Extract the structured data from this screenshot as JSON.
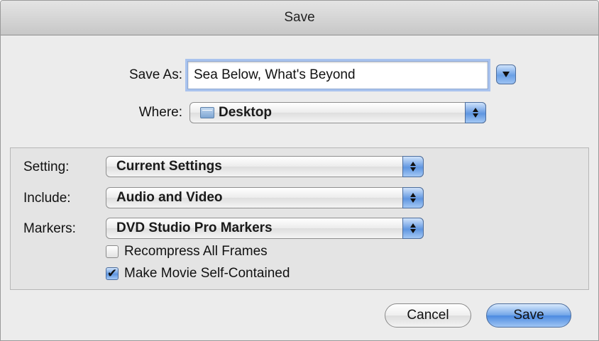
{
  "window": {
    "title": "Save"
  },
  "save_as": {
    "label": "Save As:",
    "value": "Sea Below, What's Beyond"
  },
  "where": {
    "label": "Where:",
    "value": "Desktop"
  },
  "options": {
    "setting": {
      "label": "Setting:",
      "value": "Current Settings"
    },
    "include": {
      "label": "Include:",
      "value": "Audio and Video"
    },
    "markers": {
      "label": "Markers:",
      "value": "DVD Studio Pro Markers"
    },
    "recompress": {
      "label": "Recompress All Frames",
      "checked": false
    },
    "self_contained": {
      "label": "Make Movie Self-Contained",
      "checked": true
    }
  },
  "buttons": {
    "cancel": "Cancel",
    "save": "Save"
  },
  "icons": {
    "expand": "chevron-down-icon",
    "folder": "folder-icon",
    "popup_arrows": "up-down-arrows-icon",
    "check": "checkmark-icon"
  },
  "colors": {
    "accent": "#6aa0e6",
    "focus_ring": "#a9c3ee"
  }
}
